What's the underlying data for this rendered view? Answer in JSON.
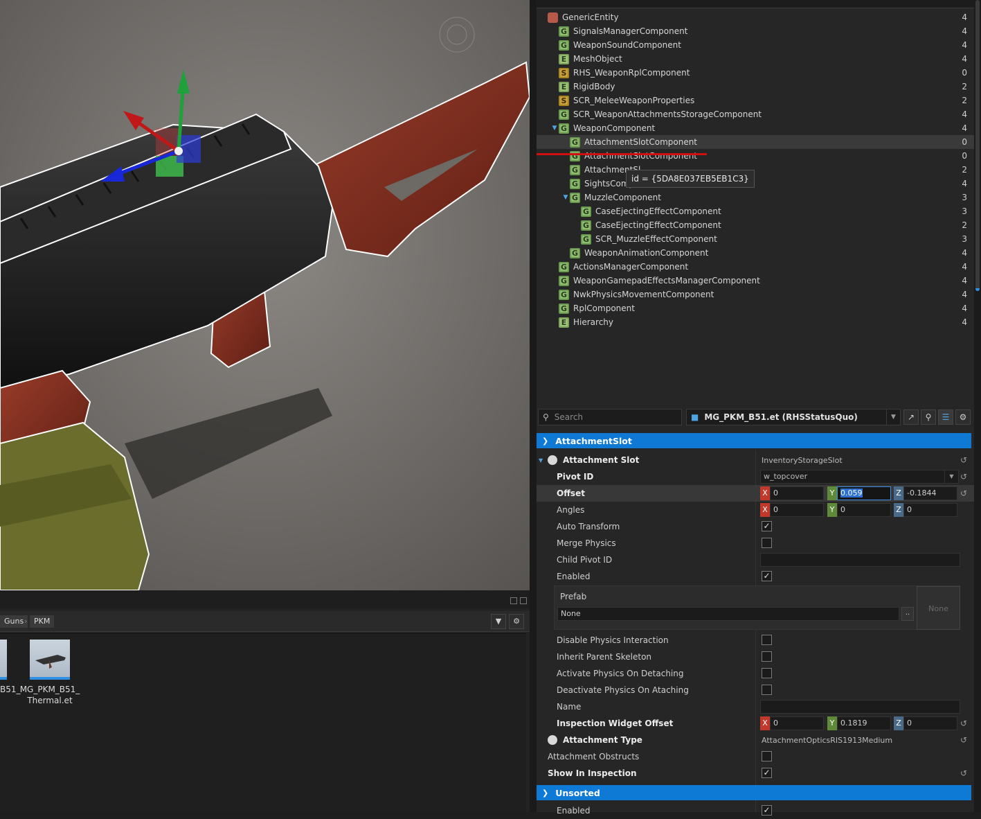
{
  "tree": {
    "items": [
      {
        "label": "GenericEntity",
        "badge": "",
        "count": "4"
      },
      {
        "label": "SignalsManagerComponent",
        "badge": "G",
        "count": "4"
      },
      {
        "label": "WeaponSoundComponent",
        "badge": "G",
        "count": "4"
      },
      {
        "label": "MeshObject",
        "badge": "E",
        "count": "4"
      },
      {
        "label": "RHS_WeaponRplComponent",
        "badge": "S",
        "count": "0"
      },
      {
        "label": "RigidBody",
        "badge": "E",
        "count": "2"
      },
      {
        "label": "SCR_MeleeWeaponProperties",
        "badge": "S",
        "count": "2"
      },
      {
        "label": "SCR_WeaponAttachmentsStorageComponent",
        "badge": "G",
        "count": "4"
      },
      {
        "label": "WeaponComponent",
        "badge": "G",
        "count": "4"
      },
      {
        "label": "AttachmentSlotComponent",
        "badge": "G",
        "count": "0"
      },
      {
        "label": "AttachmentSlotComponent",
        "badge": "G",
        "count": "0"
      },
      {
        "label": "AttachmentSl",
        "badge": "G",
        "count": "2"
      },
      {
        "label": "SightsCompo",
        "badge": "G",
        "count": "4"
      },
      {
        "label": "MuzzleComponent",
        "badge": "G",
        "count": "3"
      },
      {
        "label": "CaseEjectingEffectComponent",
        "badge": "G",
        "count": "3"
      },
      {
        "label": "CaseEjectingEffectComponent",
        "badge": "G",
        "count": "2"
      },
      {
        "label": "SCR_MuzzleEffectComponent",
        "badge": "G",
        "count": "3"
      },
      {
        "label": "WeaponAnimationComponent",
        "badge": "G",
        "count": "4"
      },
      {
        "label": "ActionsManagerComponent",
        "badge": "G",
        "count": "4"
      },
      {
        "label": "WeaponGamepadEffectsManagerComponent",
        "badge": "G",
        "count": "4"
      },
      {
        "label": "NwkPhysicsMovementComponent",
        "badge": "G",
        "count": "4"
      },
      {
        "label": "RplComponent",
        "badge": "G",
        "count": "4"
      },
      {
        "label": "Hierarchy",
        "badge": "E",
        "count": "4"
      }
    ],
    "tooltip": "id = {5DA8E037EB5EB1C3}"
  },
  "toolbar": {
    "search_placeholder": "Search",
    "entity_name": "MG_PKM_B51.et (RHSStatusQuo)"
  },
  "sections": {
    "attachment_slot": "AttachmentSlot",
    "unsorted": "Unsorted"
  },
  "props": {
    "attachment_slot": {
      "label": "Attachment Slot",
      "value": "InventoryStorageSlot"
    },
    "pivot_id": {
      "label": "Pivot ID",
      "value": "w_topcover"
    },
    "offset": {
      "label": "Offset",
      "x": "0",
      "y": "0.059",
      "z": "-0.1844"
    },
    "angles": {
      "label": "Angles",
      "x": "0",
      "y": "0",
      "z": "0"
    },
    "auto_transform": {
      "label": "Auto Transform",
      "checked": true
    },
    "merge_physics": {
      "label": "Merge Physics",
      "checked": false
    },
    "child_pivot_id": {
      "label": "Child Pivot ID"
    },
    "enabled": {
      "label": "Enabled",
      "checked": true
    },
    "prefab": {
      "label": "Prefab",
      "value": "None",
      "btn": "..",
      "preview": "None"
    },
    "disable_physics": {
      "label": "Disable Physics Interaction"
    },
    "inherit_skeleton": {
      "label": "Inherit Parent Skeleton"
    },
    "activate_physics": {
      "label": "Activate Physics On Detaching"
    },
    "deactivate_physics": {
      "label": "Deactivate Physics On Ataching"
    },
    "name": {
      "label": "Name"
    },
    "inspection_offset": {
      "label": "Inspection Widget Offset",
      "x": "0",
      "y": "0.1819",
      "z": "0"
    },
    "attachment_type": {
      "label": "Attachment Type",
      "value": "AttachmentOpticsRIS1913Medium"
    },
    "attachment_obstructs": {
      "label": "Attachment Obstructs"
    },
    "show_in_inspection": {
      "label": "Show In Inspection"
    },
    "unsorted_enabled": {
      "label": "Enabled"
    }
  },
  "axis_labels": {
    "x": "X",
    "y": "Y",
    "z": "Z"
  },
  "browser": {
    "crumbs": [
      "Guns",
      "PKM"
    ],
    "files": [
      {
        "label_line1": "B51_",
        "label_line2": ""
      },
      {
        "label_line1": "MG_PKM_B51_",
        "label_line2": "Thermal.et"
      }
    ]
  }
}
